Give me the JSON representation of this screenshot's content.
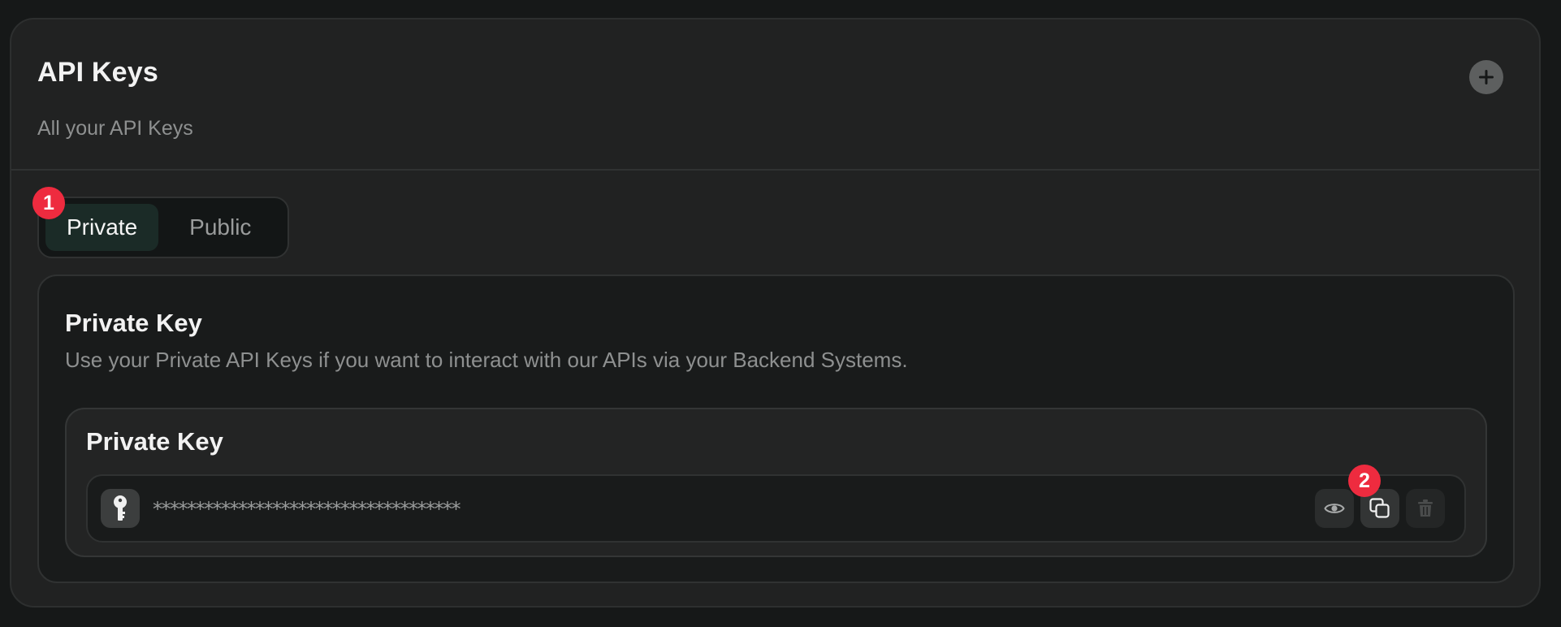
{
  "header": {
    "title": "API Keys",
    "subtitle": "All your API Keys",
    "add_icon": "plus-circle-icon"
  },
  "tabs": [
    {
      "label": "Private",
      "active": true
    },
    {
      "label": "Public",
      "active": false
    }
  ],
  "markers": {
    "tab_marker": "1",
    "copy_marker": "2"
  },
  "panel": {
    "title": "Private Key",
    "description": "Use your Private API Keys if you want to interact with our APIs via your Backend Systems.",
    "key_box": {
      "title": "Private Key",
      "key_icon": "key-icon",
      "masked_value": "************************************",
      "actions": [
        {
          "name": "view",
          "icon": "eye-icon"
        },
        {
          "name": "copy",
          "icon": "copy-icon"
        },
        {
          "name": "delete",
          "icon": "trash-icon"
        }
      ]
    }
  },
  "colors": {
    "background": "#161818",
    "card": "#212222",
    "active_tab": "#1b2b27",
    "marker": "#ee2b3f"
  }
}
